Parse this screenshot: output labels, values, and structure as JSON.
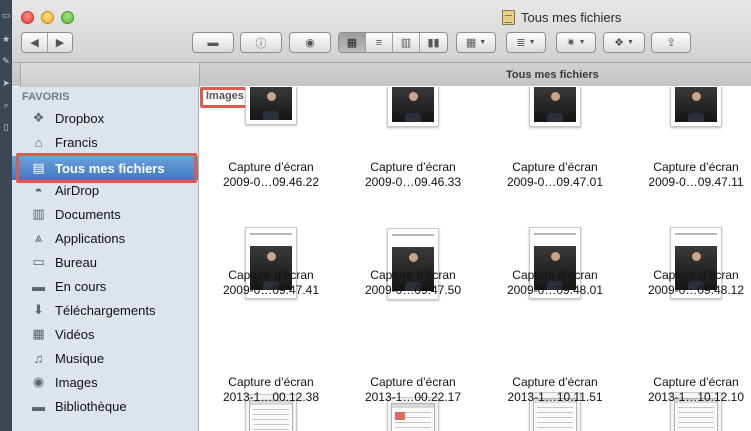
{
  "window": {
    "title": "Tous mes fichiers",
    "tab_label": "Tous mes fichiers"
  },
  "sidebar": {
    "heading": "FAVORIS",
    "items": [
      {
        "label": "Dropbox",
        "icon": "dropbox-icon",
        "glyph": "❖"
      },
      {
        "label": "Francis",
        "icon": "home-icon",
        "glyph": "⌂"
      },
      {
        "label": "Tous mes fichiers",
        "icon": "all-files-icon",
        "glyph": "▤",
        "selected": true
      },
      {
        "label": "AirDrop",
        "icon": "airdrop-icon",
        "glyph": "◓"
      },
      {
        "label": "Documents",
        "icon": "documents-icon",
        "glyph": "▥"
      },
      {
        "label": "Applications",
        "icon": "applications-icon",
        "glyph": "⩓"
      },
      {
        "label": "Bureau",
        "icon": "desktop-icon",
        "glyph": "▭"
      },
      {
        "label": "En cours",
        "icon": "in-progress-icon",
        "glyph": "▬"
      },
      {
        "label": "Téléchargements",
        "icon": "downloads-icon",
        "glyph": "⬇"
      },
      {
        "label": "Vidéos",
        "icon": "videos-icon",
        "glyph": "▦"
      },
      {
        "label": "Musique",
        "icon": "music-icon",
        "glyph": "♫"
      },
      {
        "label": "Images",
        "icon": "pictures-icon",
        "glyph": "◉"
      },
      {
        "label": "Bibliothèque",
        "icon": "library-icon",
        "glyph": "▬"
      }
    ]
  },
  "content": {
    "group_label": "Images",
    "files": [
      {
        "line1": "Capture d’écran",
        "line2": "2009-0…09.46.22",
        "kind": "photo"
      },
      {
        "line1": "Capture d’écran",
        "line2": "2009-0…09.46.33",
        "kind": "photo"
      },
      {
        "line1": "Capture d’écran",
        "line2": "2009-0…09.47.01",
        "kind": "photo"
      },
      {
        "line1": "Capture d’écran",
        "line2": "2009-0…09.47.11",
        "kind": "photo"
      },
      {
        "line1": "Capture d’écran",
        "line2": "2009-0…09.47.41",
        "kind": "photo"
      },
      {
        "line1": "Capture d’écran",
        "line2": "2009-0…09.47.50",
        "kind": "photo"
      },
      {
        "line1": "Capture d’écran",
        "line2": "2009-0…09.48.01",
        "kind": "photo"
      },
      {
        "line1": "Capture d’écran",
        "line2": "2009-0…09.48.12",
        "kind": "photo"
      },
      {
        "line1": "Capture d’écran",
        "line2": "2013-1…00.12.38",
        "kind": "screen"
      },
      {
        "line1": "Capture d’écran",
        "line2": "2013-1…00.22.17",
        "kind": "screen"
      },
      {
        "line1": "Capture d’écran",
        "line2": "2013-1…10.11.51",
        "kind": "screen"
      },
      {
        "line1": "Capture d’écran",
        "line2": "2013-1…10.12.10",
        "kind": "screen"
      }
    ]
  },
  "toolbar": {
    "colors": {
      "highlight_outline": "#e05a4a",
      "selection": "#3c78c2"
    }
  }
}
